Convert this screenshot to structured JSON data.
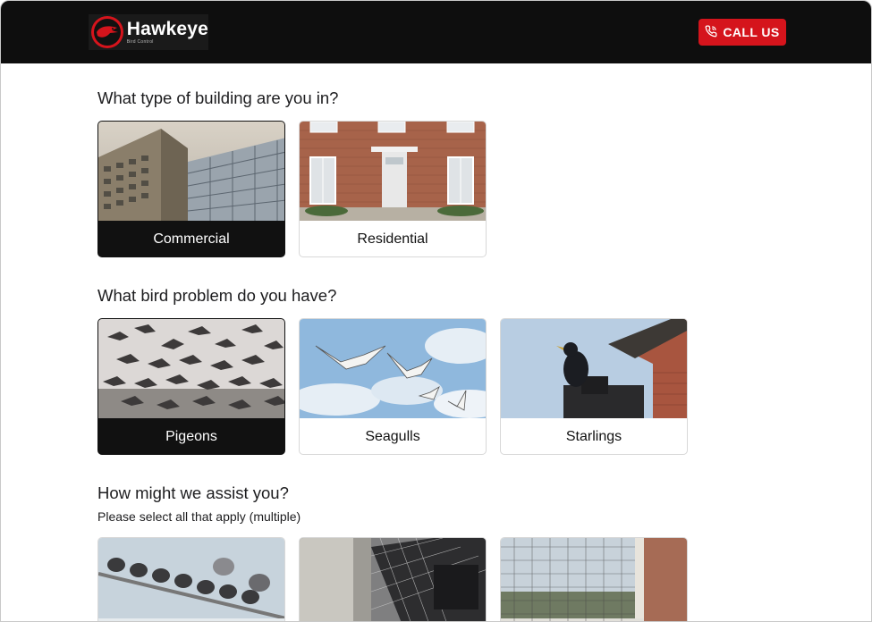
{
  "header": {
    "logo_name": "Hawkeye",
    "logo_sub": "Bird Control",
    "call_label": "CALL US"
  },
  "colors": {
    "brand_red": "#d5141c",
    "header_bg": "#0e0e0e",
    "selected_card_bg": "#111111"
  },
  "sections": {
    "building": {
      "title": "What type of building are you in?",
      "options": [
        {
          "label": "Commercial",
          "selected": true
        },
        {
          "label": "Residential",
          "selected": false
        }
      ]
    },
    "bird": {
      "title": "What bird problem do you have?",
      "options": [
        {
          "label": "Pigeons",
          "selected": true
        },
        {
          "label": "Seagulls",
          "selected": false
        },
        {
          "label": "Starlings",
          "selected": false
        }
      ]
    },
    "assist": {
      "title": "How might we assist you?",
      "subtitle": "Please select all that apply (multiple)"
    }
  },
  "icons": {
    "call": "phone-icon",
    "logo": "hawk-logo-icon"
  }
}
